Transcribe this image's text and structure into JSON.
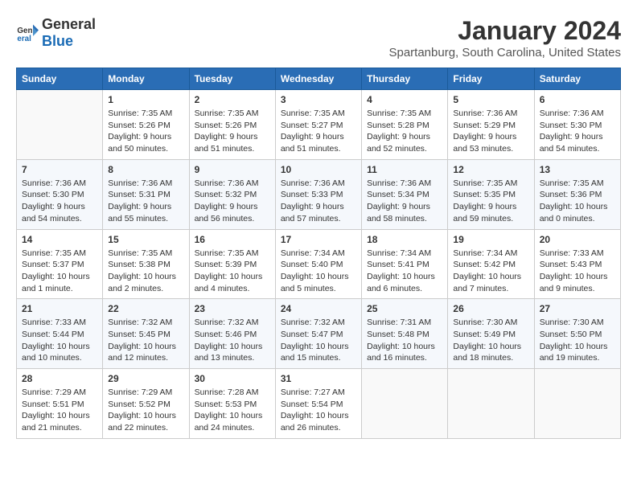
{
  "logo": {
    "general": "General",
    "blue": "Blue"
  },
  "title": "January 2024",
  "subtitle": "Spartanburg, South Carolina, United States",
  "header_days": [
    "Sunday",
    "Monday",
    "Tuesday",
    "Wednesday",
    "Thursday",
    "Friday",
    "Saturday"
  ],
  "weeks": [
    [
      {
        "day": "",
        "info": ""
      },
      {
        "day": "1",
        "info": "Sunrise: 7:35 AM\nSunset: 5:26 PM\nDaylight: 9 hours\nand 50 minutes."
      },
      {
        "day": "2",
        "info": "Sunrise: 7:35 AM\nSunset: 5:26 PM\nDaylight: 9 hours\nand 51 minutes."
      },
      {
        "day": "3",
        "info": "Sunrise: 7:35 AM\nSunset: 5:27 PM\nDaylight: 9 hours\nand 51 minutes."
      },
      {
        "day": "4",
        "info": "Sunrise: 7:35 AM\nSunset: 5:28 PM\nDaylight: 9 hours\nand 52 minutes."
      },
      {
        "day": "5",
        "info": "Sunrise: 7:36 AM\nSunset: 5:29 PM\nDaylight: 9 hours\nand 53 minutes."
      },
      {
        "day": "6",
        "info": "Sunrise: 7:36 AM\nSunset: 5:30 PM\nDaylight: 9 hours\nand 54 minutes."
      }
    ],
    [
      {
        "day": "7",
        "info": "Sunrise: 7:36 AM\nSunset: 5:30 PM\nDaylight: 9 hours\nand 54 minutes."
      },
      {
        "day": "8",
        "info": "Sunrise: 7:36 AM\nSunset: 5:31 PM\nDaylight: 9 hours\nand 55 minutes."
      },
      {
        "day": "9",
        "info": "Sunrise: 7:36 AM\nSunset: 5:32 PM\nDaylight: 9 hours\nand 56 minutes."
      },
      {
        "day": "10",
        "info": "Sunrise: 7:36 AM\nSunset: 5:33 PM\nDaylight: 9 hours\nand 57 minutes."
      },
      {
        "day": "11",
        "info": "Sunrise: 7:36 AM\nSunset: 5:34 PM\nDaylight: 9 hours\nand 58 minutes."
      },
      {
        "day": "12",
        "info": "Sunrise: 7:35 AM\nSunset: 5:35 PM\nDaylight: 9 hours\nand 59 minutes."
      },
      {
        "day": "13",
        "info": "Sunrise: 7:35 AM\nSunset: 5:36 PM\nDaylight: 10 hours\nand 0 minutes."
      }
    ],
    [
      {
        "day": "14",
        "info": "Sunrise: 7:35 AM\nSunset: 5:37 PM\nDaylight: 10 hours\nand 1 minute."
      },
      {
        "day": "15",
        "info": "Sunrise: 7:35 AM\nSunset: 5:38 PM\nDaylight: 10 hours\nand 2 minutes."
      },
      {
        "day": "16",
        "info": "Sunrise: 7:35 AM\nSunset: 5:39 PM\nDaylight: 10 hours\nand 4 minutes."
      },
      {
        "day": "17",
        "info": "Sunrise: 7:34 AM\nSunset: 5:40 PM\nDaylight: 10 hours\nand 5 minutes."
      },
      {
        "day": "18",
        "info": "Sunrise: 7:34 AM\nSunset: 5:41 PM\nDaylight: 10 hours\nand 6 minutes."
      },
      {
        "day": "19",
        "info": "Sunrise: 7:34 AM\nSunset: 5:42 PM\nDaylight: 10 hours\nand 7 minutes."
      },
      {
        "day": "20",
        "info": "Sunrise: 7:33 AM\nSunset: 5:43 PM\nDaylight: 10 hours\nand 9 minutes."
      }
    ],
    [
      {
        "day": "21",
        "info": "Sunrise: 7:33 AM\nSunset: 5:44 PM\nDaylight: 10 hours\nand 10 minutes."
      },
      {
        "day": "22",
        "info": "Sunrise: 7:32 AM\nSunset: 5:45 PM\nDaylight: 10 hours\nand 12 minutes."
      },
      {
        "day": "23",
        "info": "Sunrise: 7:32 AM\nSunset: 5:46 PM\nDaylight: 10 hours\nand 13 minutes."
      },
      {
        "day": "24",
        "info": "Sunrise: 7:32 AM\nSunset: 5:47 PM\nDaylight: 10 hours\nand 15 minutes."
      },
      {
        "day": "25",
        "info": "Sunrise: 7:31 AM\nSunset: 5:48 PM\nDaylight: 10 hours\nand 16 minutes."
      },
      {
        "day": "26",
        "info": "Sunrise: 7:30 AM\nSunset: 5:49 PM\nDaylight: 10 hours\nand 18 minutes."
      },
      {
        "day": "27",
        "info": "Sunrise: 7:30 AM\nSunset: 5:50 PM\nDaylight: 10 hours\nand 19 minutes."
      }
    ],
    [
      {
        "day": "28",
        "info": "Sunrise: 7:29 AM\nSunset: 5:51 PM\nDaylight: 10 hours\nand 21 minutes."
      },
      {
        "day": "29",
        "info": "Sunrise: 7:29 AM\nSunset: 5:52 PM\nDaylight: 10 hours\nand 22 minutes."
      },
      {
        "day": "30",
        "info": "Sunrise: 7:28 AM\nSunset: 5:53 PM\nDaylight: 10 hours\nand 24 minutes."
      },
      {
        "day": "31",
        "info": "Sunrise: 7:27 AM\nSunset: 5:54 PM\nDaylight: 10 hours\nand 26 minutes."
      },
      {
        "day": "",
        "info": ""
      },
      {
        "day": "",
        "info": ""
      },
      {
        "day": "",
        "info": ""
      }
    ]
  ]
}
